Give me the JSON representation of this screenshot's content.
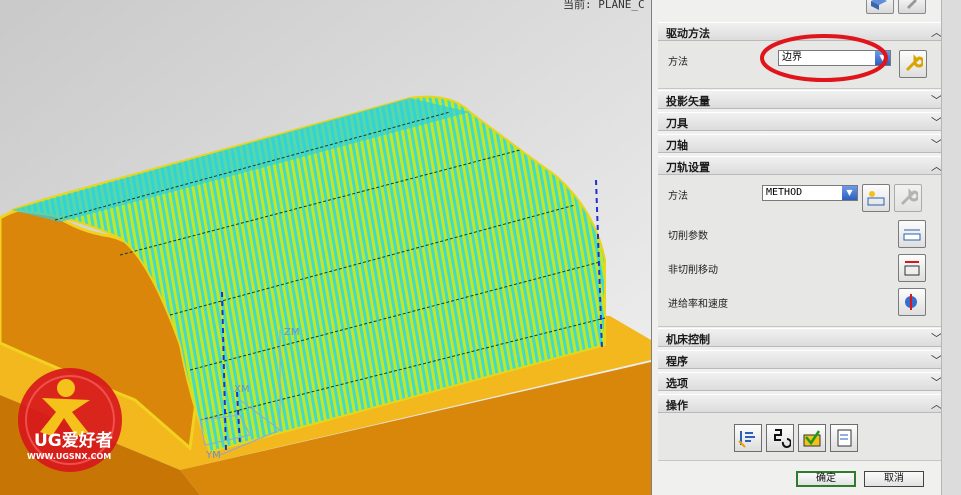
{
  "viewport": {
    "status_text": "当前: PLANE_C",
    "axis_zm": "ZM",
    "axis_xm": "XM",
    "axis_ym": "YM",
    "logo_name": "UG爱好者",
    "logo_url": "WWW.UGSNX.COM"
  },
  "panel": {
    "sections": {
      "drive_method": "驱动方法",
      "projection_vector": "投影矢量",
      "tool": "刀具",
      "tool_axis": "刀轴",
      "path_settings": "刀轨设置",
      "machine_control": "机床控制",
      "program": "程序",
      "options": "选项",
      "actions": "操作"
    },
    "drive_method_body": {
      "method_label": "方法",
      "method_value": "边界"
    },
    "path_settings_body": {
      "method_label": "方法",
      "method_value": "METHOD",
      "cut_params": "切削参数",
      "non_cut_moves": "非切削移动",
      "feeds_speeds": "进给率和速度"
    },
    "buttons": {
      "ok": "确定",
      "cancel": "取消"
    }
  },
  "colors": {
    "surface_stock": "#d8870a",
    "toolpath_cyan": "#1ad9e8",
    "toolpath_yellow": "#f0e21c",
    "annotation_red": "#e0151b"
  }
}
